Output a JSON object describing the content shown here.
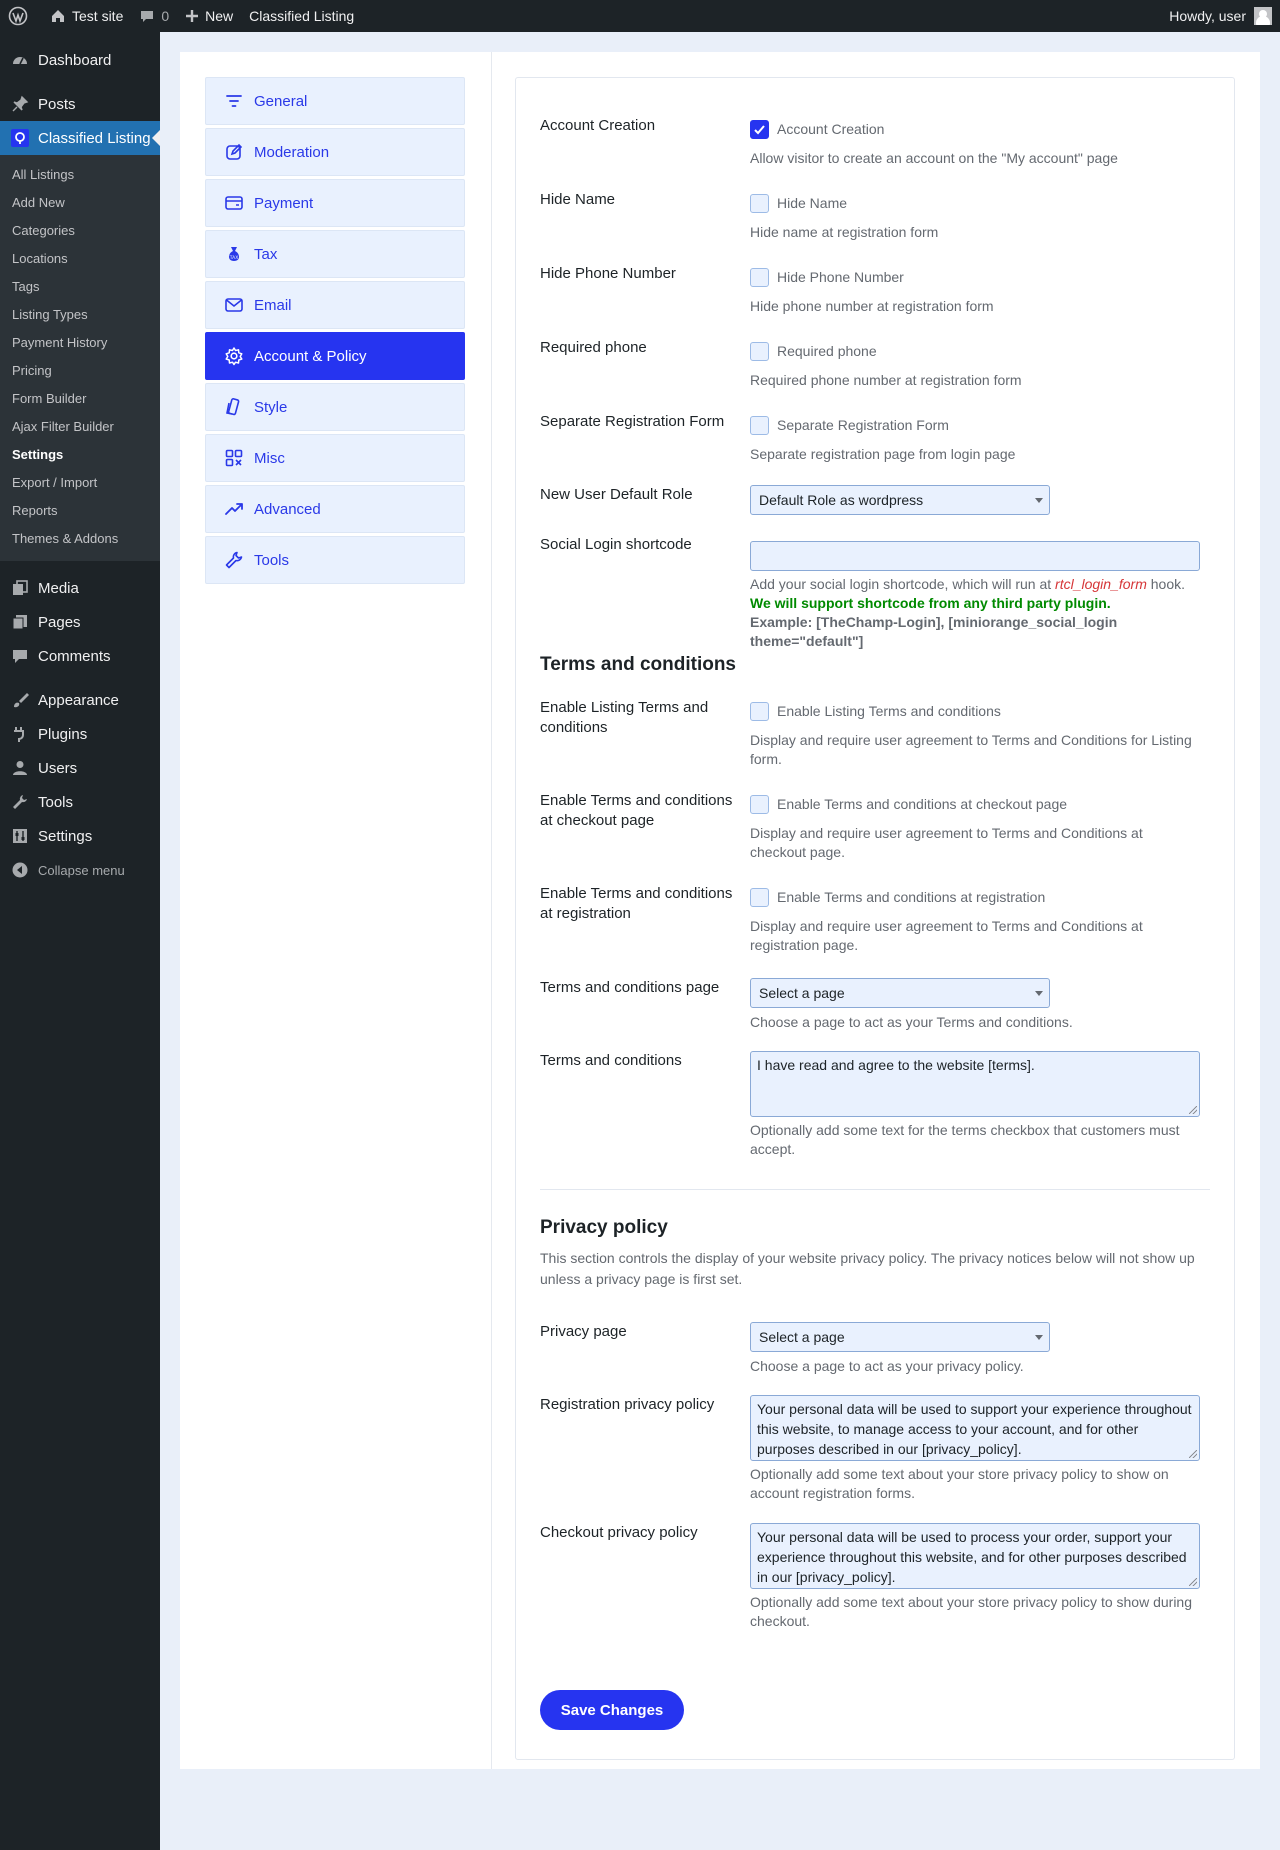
{
  "adminbar": {
    "site": "Test site",
    "comments_count": "0",
    "new_label": "New",
    "plugin": "Classified Listing",
    "howdy": "Howdy, user"
  },
  "sidebar": {
    "dashboard": "Dashboard",
    "posts": "Posts",
    "classified": "Classified Listing",
    "sub": [
      "All Listings",
      "Add New",
      "Categories",
      "Locations",
      "Tags",
      "Listing Types",
      "Payment History",
      "Pricing",
      "Form Builder",
      "Ajax Filter Builder",
      "Settings",
      "Export / Import",
      "Reports",
      "Themes & Addons"
    ],
    "media": "Media",
    "pages": "Pages",
    "comments": "Comments",
    "appearance": "Appearance",
    "plugins": "Plugins",
    "users": "Users",
    "tools": "Tools",
    "settings": "Settings",
    "collapse": "Collapse menu"
  },
  "tabs": [
    "General",
    "Moderation",
    "Payment",
    "Tax",
    "Email",
    "Account & Policy",
    "Style",
    "Misc",
    "Advanced",
    "Tools"
  ],
  "fields": {
    "account_creation": {
      "label": "Account Creation",
      "cb": "Account Creation",
      "desc": "Allow visitor to create an account on the \"My account\" page",
      "checked": true
    },
    "hide_name": {
      "label": "Hide Name",
      "cb": "Hide Name",
      "desc": "Hide name at registration form"
    },
    "hide_phone": {
      "label": "Hide Phone Number",
      "cb": "Hide Phone Number",
      "desc": "Hide phone number at registration form"
    },
    "required_phone": {
      "label": "Required phone",
      "cb": "Required phone",
      "desc": "Required phone number at registration form"
    },
    "separate_reg": {
      "label": "Separate Registration Form",
      "cb": "Separate Registration Form",
      "desc": "Separate registration page from login page"
    },
    "default_role": {
      "label": "New User Default Role",
      "value": "Default Role as wordpress"
    },
    "social_login": {
      "label": "Social Login shortcode",
      "desc_pre": "Add your social login shortcode, which will run at ",
      "desc_code": "rtcl_login_form",
      "desc_post": " hook.",
      "green": "We will support shortcode from any third party plugin.",
      "example": "Example: [TheChamp-Login], [miniorange_social_login theme=\"default\"]"
    }
  },
  "terms": {
    "title": "Terms and conditions",
    "listing": {
      "label": "Enable Listing Terms and conditions",
      "cb": "Enable Listing Terms and conditions",
      "desc": "Display and require user agreement to Terms and Conditions for Listing form."
    },
    "checkout": {
      "label": "Enable Terms and conditions at checkout page",
      "cb": "Enable Terms and conditions at checkout page",
      "desc": "Display and require user agreement to Terms and Conditions at checkout page."
    },
    "registration": {
      "label": "Enable Terms and conditions at registration",
      "cb": "Enable Terms and conditions at registration",
      "desc": "Display and require user agreement to Terms and Conditions at registration page."
    },
    "page": {
      "label": "Terms and conditions page",
      "value": "Select a page",
      "desc": "Choose a page to act as your Terms and conditions."
    },
    "text": {
      "label": "Terms and conditions",
      "value": "I have read and agree to the website [terms].",
      "desc": "Optionally add some text for the terms checkbox that customers must accept."
    }
  },
  "privacy": {
    "title": "Privacy policy",
    "intro": "This section controls the display of your website privacy policy. The privacy notices below will not show up unless a privacy page is first set.",
    "page": {
      "label": "Privacy page",
      "value": "Select a page",
      "desc": "Choose a page to act as your privacy policy."
    },
    "registration": {
      "label": "Registration privacy policy",
      "value": "Your personal data will be used to support your experience throughout this website, to manage access to your account, and for other purposes described in our [privacy_policy].",
      "desc": "Optionally add some text about your store privacy policy to show on account registration forms."
    },
    "checkout": {
      "label": "Checkout privacy policy",
      "value": "Your personal data will be used to process your order, support your experience throughout this website, and for other purposes described in our [privacy_policy].",
      "desc": "Optionally add some text about your store privacy policy to show during checkout."
    }
  },
  "save_label": "Save Changes",
  "colors": {
    "accent": "#2634f0",
    "admin_dark": "#1d2327",
    "wp_blue": "#2271b1",
    "green": "#008a00",
    "code_red": "#d63638"
  }
}
